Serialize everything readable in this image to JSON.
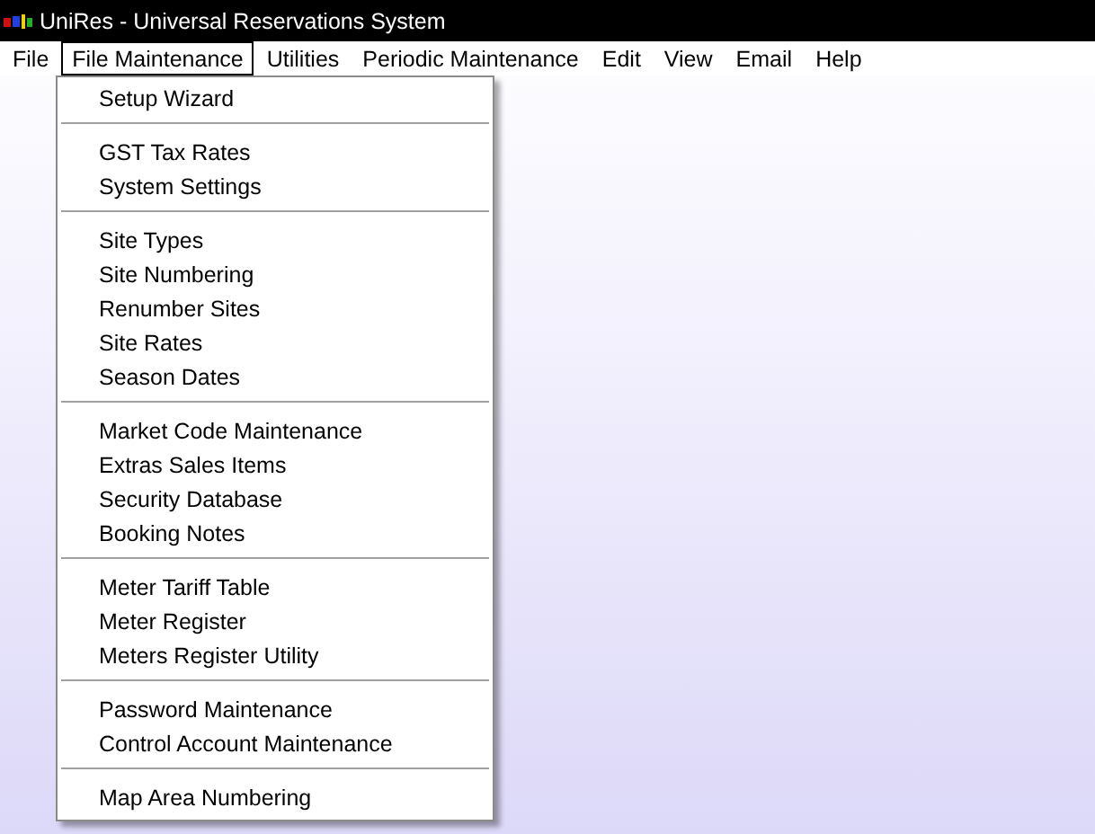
{
  "window": {
    "title": "UniRes - Universal Reservations System"
  },
  "menubar": [
    {
      "label": "File",
      "selected": false
    },
    {
      "label": "File Maintenance",
      "selected": true
    },
    {
      "label": "Utilities",
      "selected": false
    },
    {
      "label": "Periodic Maintenance",
      "selected": false
    },
    {
      "label": "Edit",
      "selected": false
    },
    {
      "label": "View",
      "selected": false
    },
    {
      "label": "Email",
      "selected": false
    },
    {
      "label": "Help",
      "selected": false
    }
  ],
  "menu": {
    "groups": [
      [
        "Setup Wizard"
      ],
      [
        "GST Tax Rates",
        "System Settings"
      ],
      [
        "Site Types",
        "Site Numbering",
        "Renumber Sites",
        "Site Rates",
        "Season Dates"
      ],
      [
        "Market Code Maintenance",
        "Extras Sales Items",
        "Security Database",
        "Booking Notes"
      ],
      [
        "Meter Tariff Table",
        "Meter Register",
        "Meters Register Utility"
      ],
      [
        "Password Maintenance",
        "Control Account Maintenance"
      ],
      [
        "Map Area Numbering"
      ]
    ]
  }
}
